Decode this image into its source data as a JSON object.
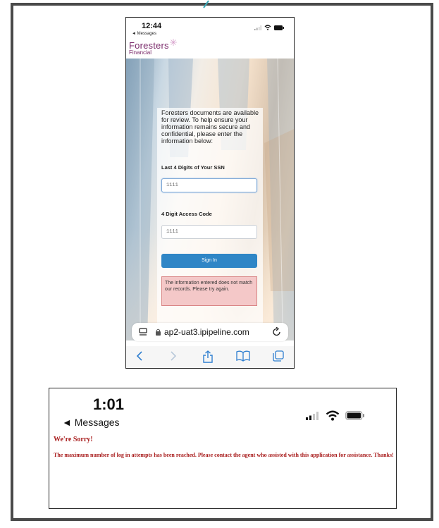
{
  "screen1": {
    "status": {
      "time": "12:44",
      "back_label": "◄ Messages"
    },
    "brand": {
      "name": "Foresters",
      "subname": "Financial"
    },
    "intro_text": "Foresters documents are available for review. To help ensure your information remains secure and confidential, please enter the information below:",
    "ssn": {
      "label": "Last 4 Digits of Your SSN",
      "value": "1111"
    },
    "access_code": {
      "label": "4 Digit Access Code",
      "value": "1111"
    },
    "sign_in_label": "Sign In",
    "error_text": "The information entered does not match our records. Please try again.",
    "url": "ap2-uat3.ipipeline.com",
    "colors": {
      "brand": "#7a2a6a",
      "button": "#2f86c6",
      "error_bg": "#f4c8c8"
    }
  },
  "screen2": {
    "status": {
      "time": "1:01",
      "back_label": "◄ Messages"
    },
    "title": "We're Sorry!",
    "message": "The maximum number of log in attempts has been reached. Please contact the agent who assisted with this application for assistance. Thanks!",
    "colors": {
      "message": "#a81c1c"
    }
  }
}
